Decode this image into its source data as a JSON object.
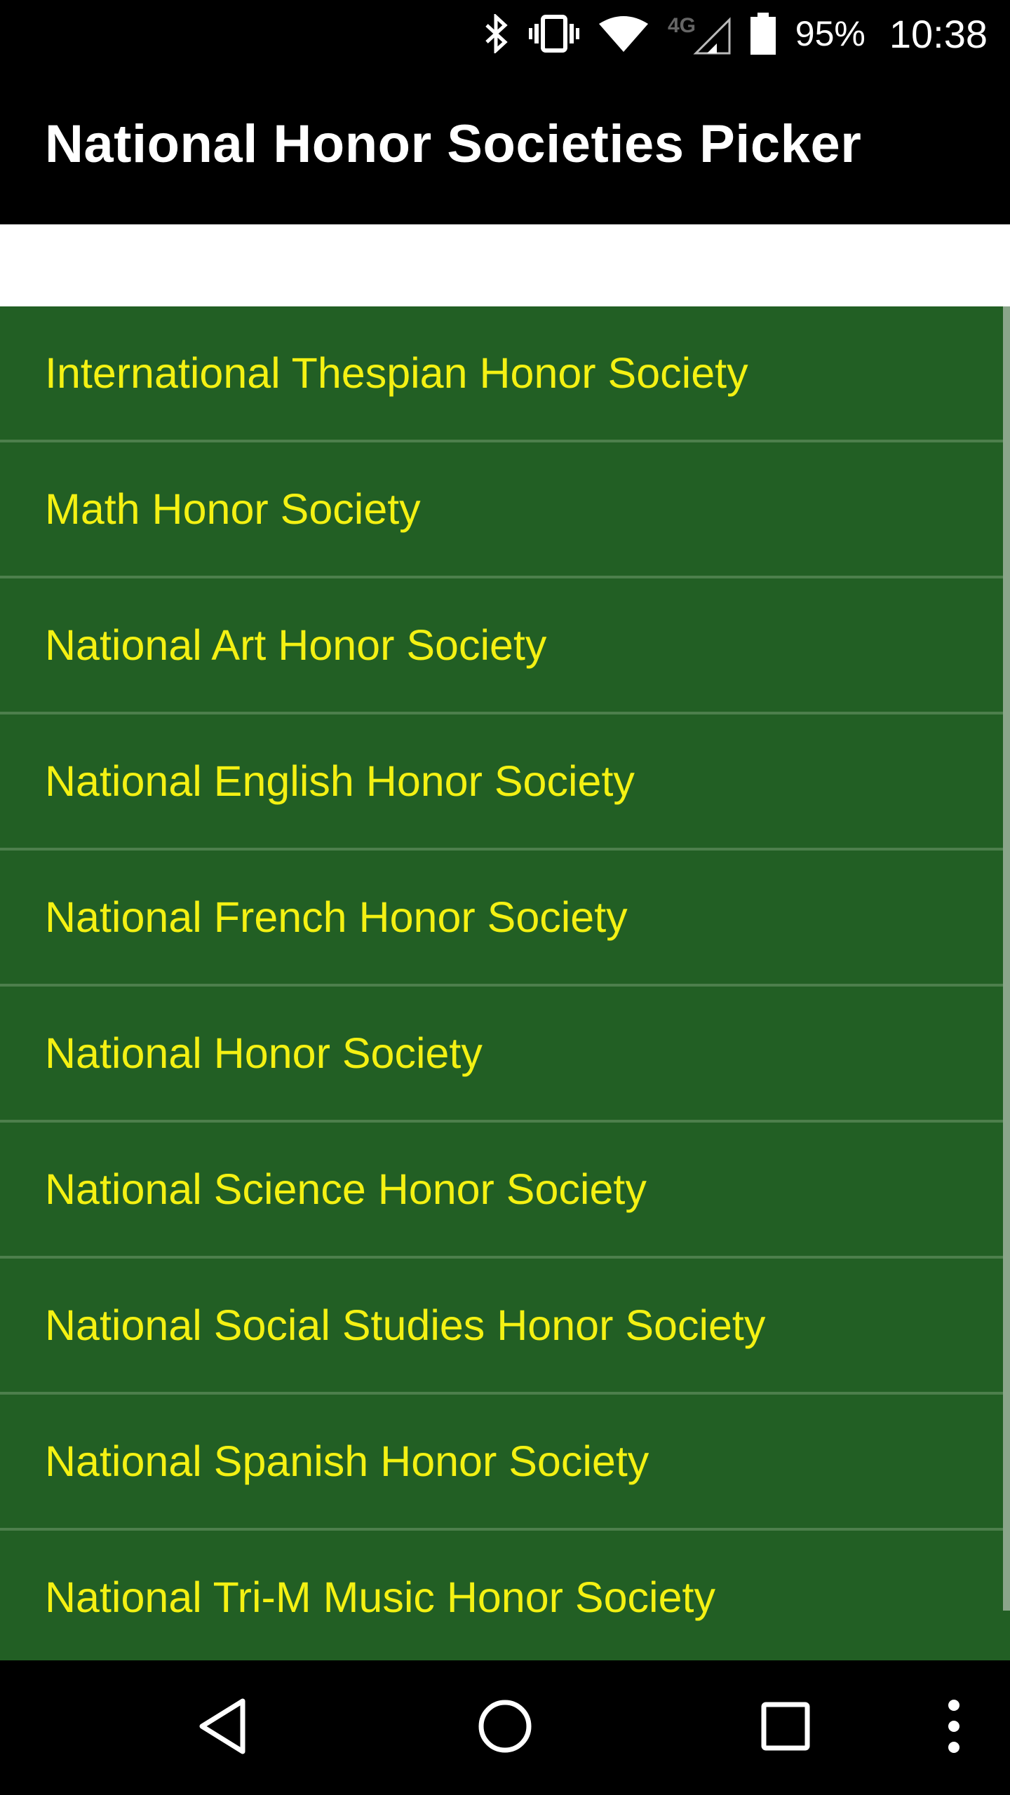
{
  "status_bar": {
    "battery_percent": "95%",
    "time": "10:38",
    "network_label": "4G"
  },
  "app_bar": {
    "title": "National Honor Societies Picker"
  },
  "list": {
    "items": [
      {
        "label": "International Thespian Honor Society"
      },
      {
        "label": "Math Honor Society"
      },
      {
        "label": "National Art Honor Society"
      },
      {
        "label": "National English Honor Society"
      },
      {
        "label": "National French Honor Society"
      },
      {
        "label": "National Honor Society"
      },
      {
        "label": "National Science Honor Society"
      },
      {
        "label": "National Social Studies Honor Society"
      },
      {
        "label": "National Spanish Honor Society"
      },
      {
        "label": "National Tri-M Music Honor Society"
      }
    ]
  },
  "colors": {
    "list_background": "#225f24",
    "list_text": "#f4f113",
    "divider": "#4d7f4c",
    "app_bar_background": "#000000"
  },
  "icons": {
    "status": [
      "bluetooth-icon",
      "vibrate-icon",
      "wifi-icon",
      "signal-icon",
      "battery-icon"
    ],
    "navigation": [
      "back-icon",
      "home-icon",
      "recents-icon",
      "overflow-menu-icon"
    ]
  }
}
